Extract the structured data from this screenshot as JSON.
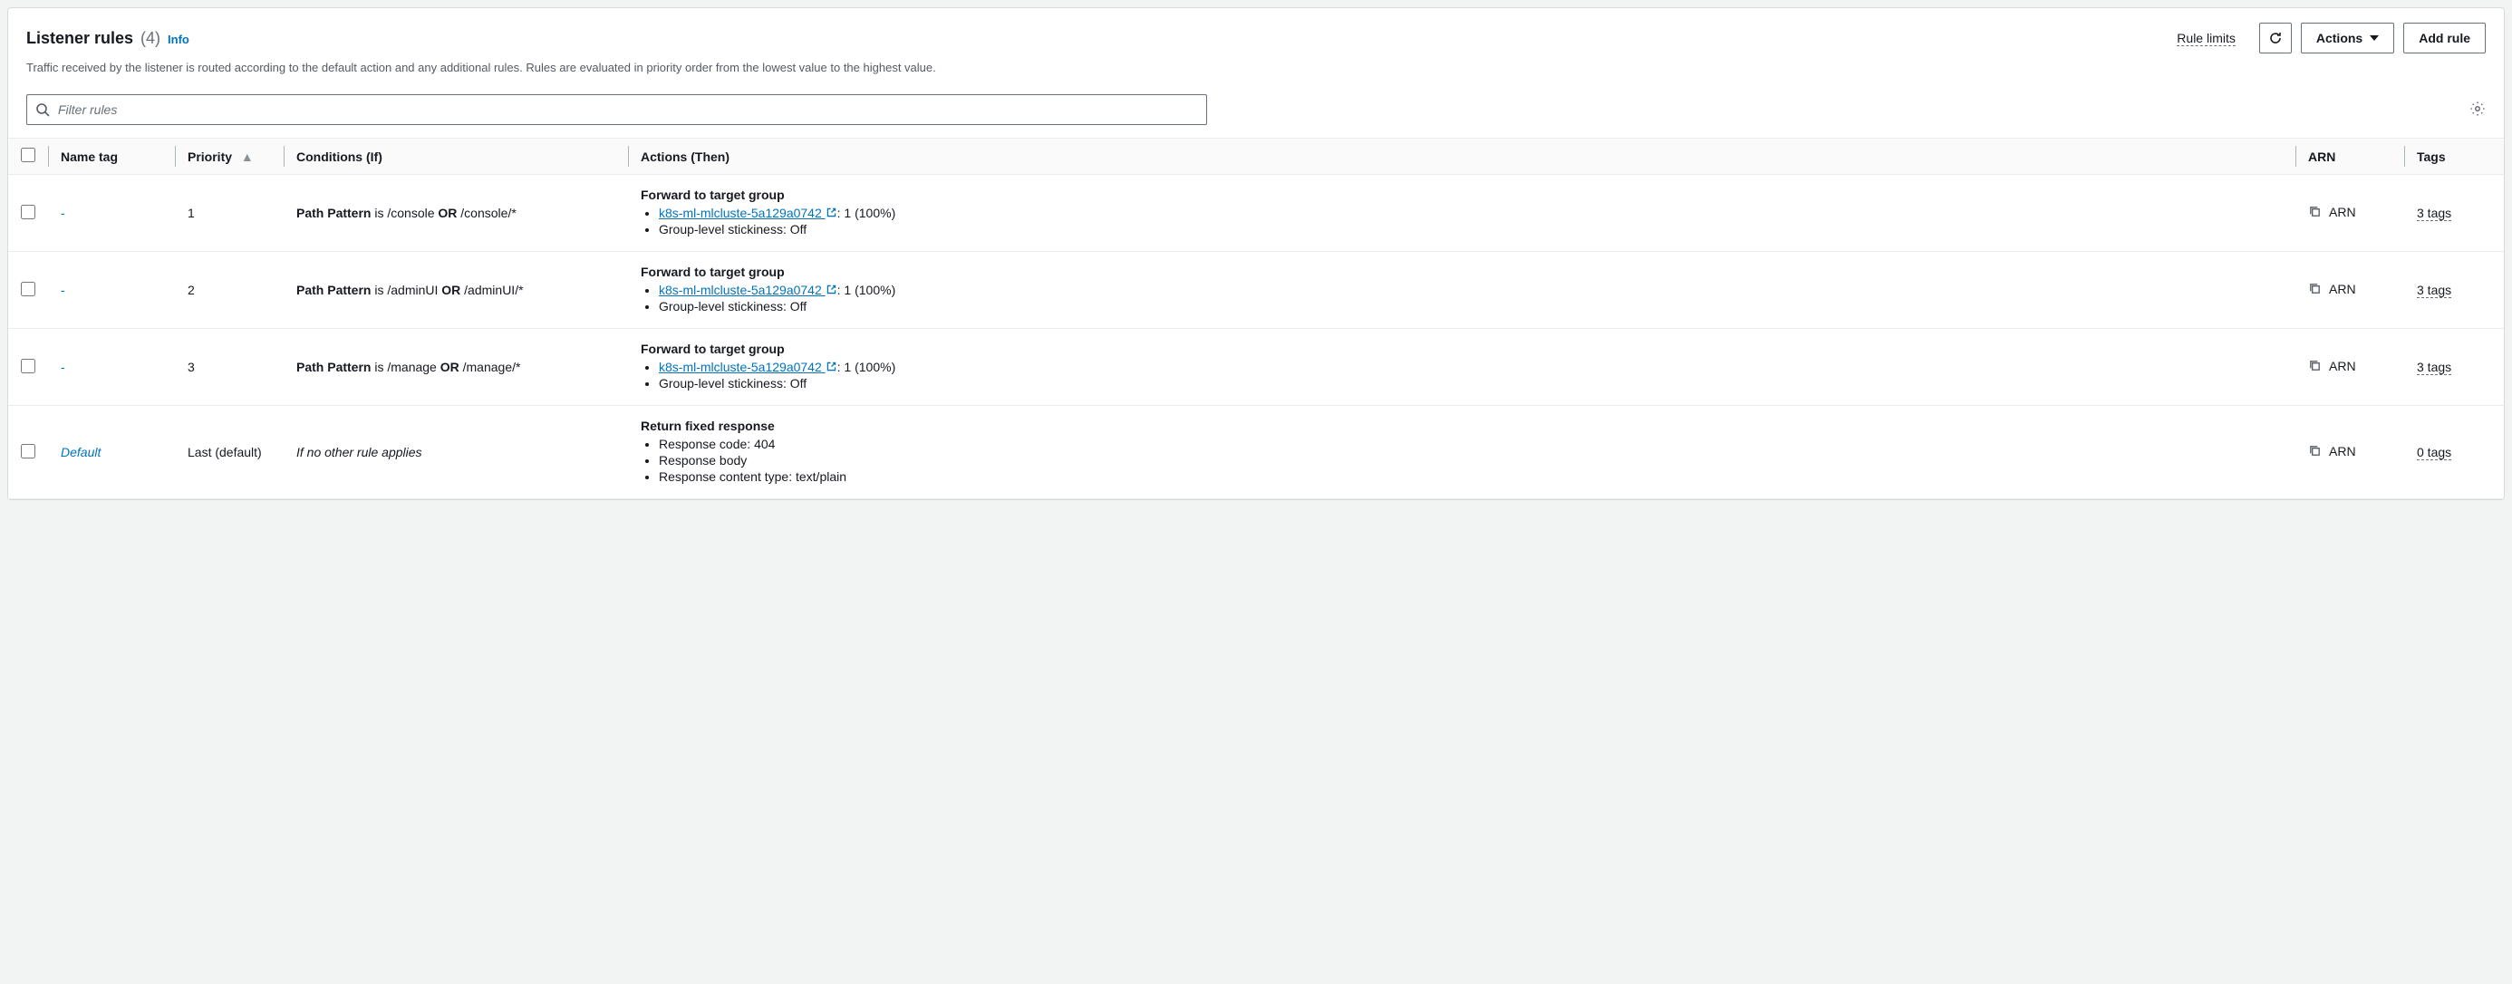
{
  "header": {
    "title": "Listener rules",
    "count": "(4)",
    "info": "Info",
    "description": "Traffic received by the listener is routed according to the default action and any additional rules. Rules are evaluated in priority order from the lowest value to the highest value.",
    "rule_limits": "Rule limits",
    "actions_btn": "Actions",
    "add_rule_btn": "Add rule"
  },
  "filter": {
    "placeholder": "Filter rules"
  },
  "columns": {
    "name": "Name tag",
    "priority": "Priority",
    "conditions": "Conditions (If)",
    "actions": "Actions (Then)",
    "arn": "ARN",
    "tags": "Tags"
  },
  "labels": {
    "forward_title": "Forward to target group",
    "fixed_title": "Return fixed response",
    "stickiness": "Group-level stickiness: Off",
    "resp_code_prefix": "Response code: ",
    "resp_body": "Response body",
    "resp_type_prefix": "Response content type: ",
    "arn": "ARN",
    "path_pattern": "Path Pattern",
    "is": " is ",
    "or": " OR ",
    "default_cond": "If no other rule applies"
  },
  "rules": [
    {
      "name": "-",
      "name_is_link": false,
      "priority": "1",
      "condition": {
        "paths": [
          "/console",
          "/console/*"
        ]
      },
      "action": {
        "type": "forward",
        "target_name": "k8s-ml-mlcluste-5a129a0742",
        "target_suffix": ": 1 (100%)"
      },
      "tags": "3 tags"
    },
    {
      "name": "-",
      "name_is_link": false,
      "priority": "2",
      "condition": {
        "paths": [
          "/adminUI",
          "/adminUI/*"
        ]
      },
      "action": {
        "type": "forward",
        "target_name": "k8s-ml-mlcluste-5a129a0742",
        "target_suffix": ": 1 (100%)"
      },
      "tags": "3 tags"
    },
    {
      "name": "-",
      "name_is_link": false,
      "priority": "3",
      "condition": {
        "paths": [
          "/manage",
          "/manage/*"
        ]
      },
      "action": {
        "type": "forward",
        "target_name": "k8s-ml-mlcluste-5a129a0742",
        "target_suffix": ": 1 (100%)"
      },
      "tags": "3 tags"
    },
    {
      "name": "Default",
      "name_is_link": true,
      "priority": "Last (default)",
      "condition": null,
      "action": {
        "type": "fixed",
        "code": "404",
        "content_type": "text/plain"
      },
      "tags": "0 tags"
    }
  ]
}
